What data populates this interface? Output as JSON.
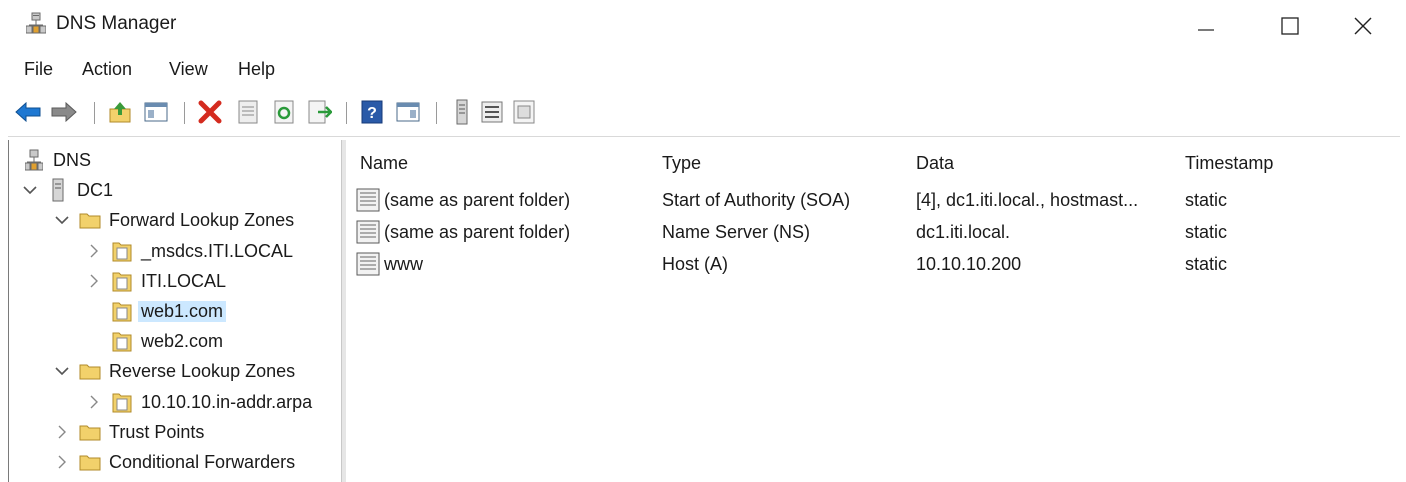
{
  "window": {
    "title": "DNS Manager",
    "controls": {
      "minimize": "—",
      "maximize": "☐",
      "close": "✕"
    }
  },
  "menu": [
    "File",
    "Action",
    "View",
    "Help"
  ],
  "toolbar": {
    "buttons": [
      "back-icon",
      "forward-icon",
      "up-folder-icon",
      "show-hide-tree-icon",
      "delete-icon",
      "properties-icon",
      "refresh-icon",
      "export-list-icon",
      "help-icon",
      "console-view-icon",
      "dns-server-icon",
      "list-icon",
      "record-icon"
    ]
  },
  "tree": {
    "root": "DNS",
    "server": "DC1",
    "forward_zones": {
      "label": "Forward Lookup Zones",
      "children": [
        "_msdcs.ITI.LOCAL",
        "ITI.LOCAL",
        "web1.com",
        "web2.com"
      ]
    },
    "reverse_zones": {
      "label": "Reverse Lookup Zones",
      "children": [
        "10.10.10.in-addr.arpa"
      ]
    },
    "trust_points": "Trust Points",
    "conditional_forwarders": "Conditional Forwarders"
  },
  "list": {
    "columns": [
      "Name",
      "Type",
      "Data",
      "Timestamp"
    ],
    "rows": [
      {
        "name": "(same as parent folder)",
        "type": "Start of Authority (SOA)",
        "data": "[4], dc1.iti.local., hostmast...",
        "timestamp": "static"
      },
      {
        "name": "(same as parent folder)",
        "type": "Name Server (NS)",
        "data": "dc1.iti.local.",
        "timestamp": "static"
      },
      {
        "name": "www",
        "type": "Host (A)",
        "data": "10.10.10.200",
        "timestamp": "static"
      }
    ]
  },
  "colors": {
    "selection": "#cce8ff",
    "folder": "#f2d16b",
    "accent_blue": "#1e78d2",
    "delete_red": "#d42b1f"
  }
}
